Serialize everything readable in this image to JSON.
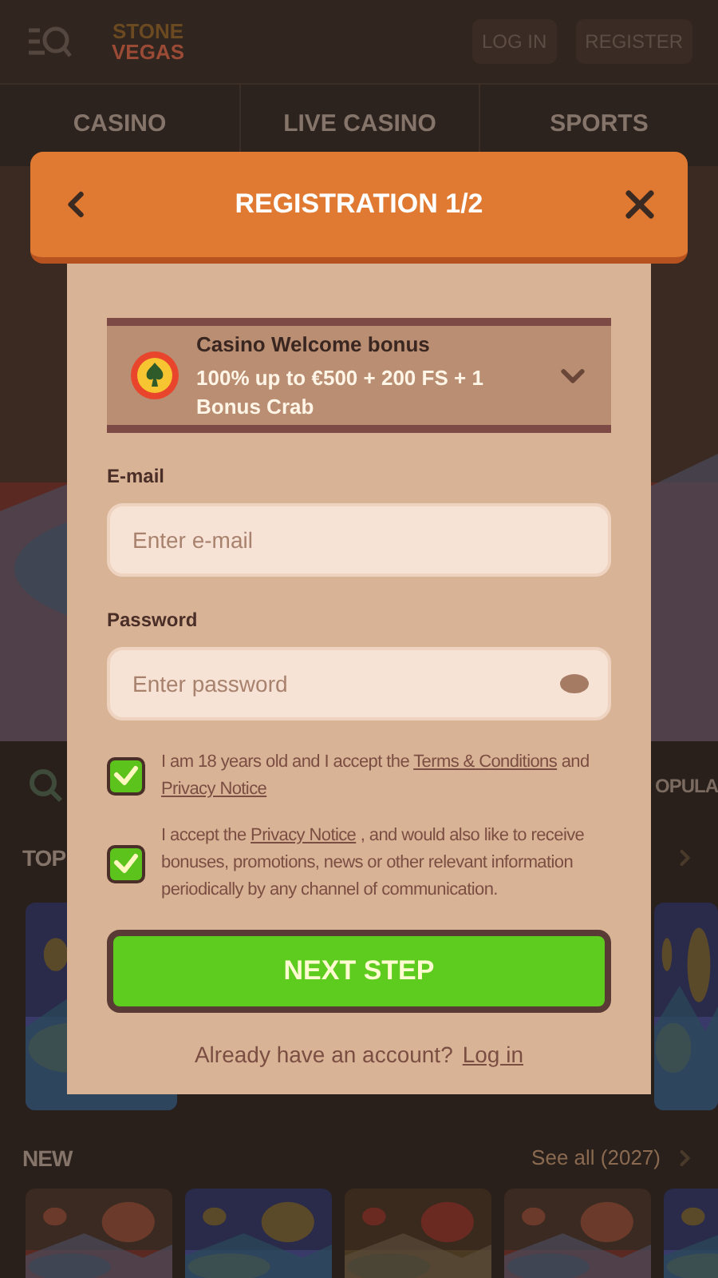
{
  "header": {
    "logo": [
      "STONE",
      "VEGAS"
    ],
    "buttons": [
      "LOG IN",
      "REGISTER"
    ]
  },
  "nav": [
    "CASINO",
    "LIVE CASINO",
    "SPORTS"
  ],
  "background": {
    "search_label": "OPULA",
    "sections": [
      {
        "title": "TOP"
      },
      {
        "title": "NEW",
        "link": "See all (2027)"
      }
    ]
  },
  "modal": {
    "title": "REGISTRATION 1/2",
    "bonus": {
      "title": "Casino Welcome bonus",
      "offer": "100% up to €500 + 200 FS + 1 Bonus Crab"
    },
    "fields": [
      {
        "kind": "text",
        "label": "E-mail",
        "placeholder": "Enter e-mail"
      },
      {
        "kind": "password",
        "label": "Password",
        "placeholder": "Enter password"
      }
    ],
    "consents": [
      {
        "checked": true,
        "segments": [
          {
            "kind": "text",
            "text": "I am 18 years old and I accept the "
          },
          {
            "kind": "link",
            "text": "Terms & Conditions"
          },
          {
            "kind": "text",
            "text": " and "
          },
          {
            "kind": "link",
            "text": "Privacy Notice"
          }
        ]
      },
      {
        "checked": true,
        "segments": [
          {
            "kind": "text",
            "text": "I accept the "
          },
          {
            "kind": "link",
            "text": "Privacy Notice"
          },
          {
            "kind": "text",
            "text": " , and would also like to receive bonuses, promotions, news or other relevant information periodically by any channel of communication."
          }
        ]
      }
    ],
    "submit": "NEXT STEP",
    "footer": {
      "text": "Already have an account?",
      "link": "Log in"
    }
  }
}
